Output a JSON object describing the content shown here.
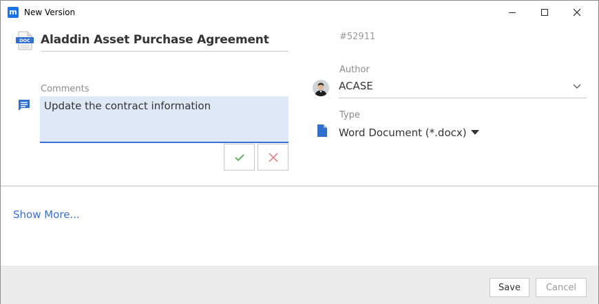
{
  "window": {
    "title": "New Version",
    "app_icon_letter": "m"
  },
  "document": {
    "title": "Aladdin Asset Purchase Agreement",
    "icon_label": "DOC",
    "id": "#52911"
  },
  "comments": {
    "label": "Comments",
    "value": "Update the contract information"
  },
  "author": {
    "label": "Author",
    "value": "ACASE"
  },
  "type": {
    "label": "Type",
    "value": "Word Document (*.docx)"
  },
  "links": {
    "show_more": "Show More..."
  },
  "footer": {
    "save_label": "Save",
    "cancel_label": "Cancel"
  },
  "colors": {
    "accent": "#3a6fd8",
    "app_icon": "#1a73e8",
    "comment_bg": "#dfe8f6",
    "accept": "#4caf50",
    "reject": "#e57373",
    "footer_bg": "#ececec"
  }
}
